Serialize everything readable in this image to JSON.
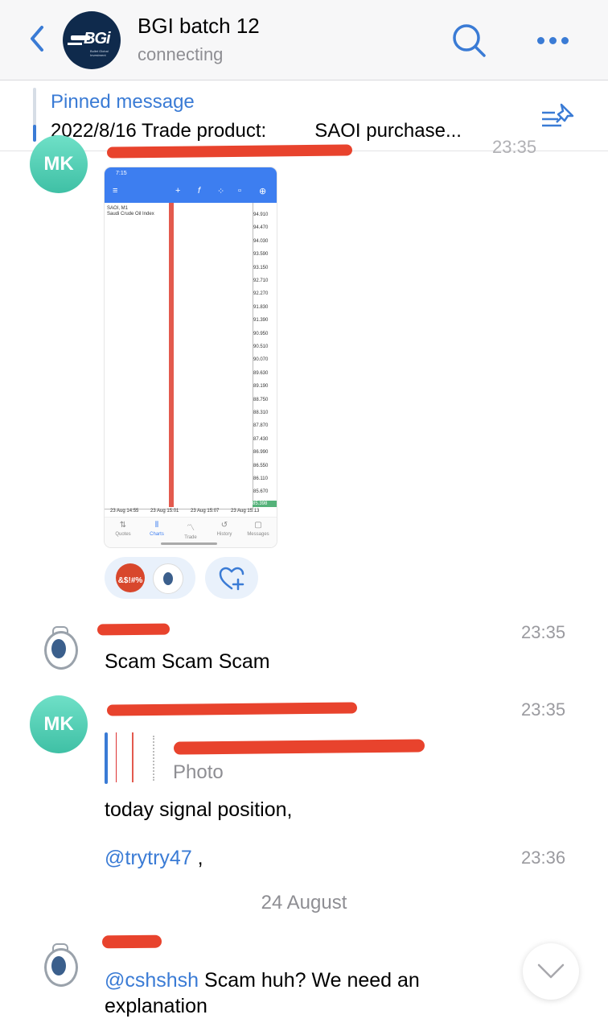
{
  "header": {
    "title": "BGI batch 12",
    "status": "connecting",
    "logo_text": "BGi",
    "logo_subtext": "Bullet Global Investment"
  },
  "pinned": {
    "label": "Pinned message",
    "text": "2022/8/16 Trade product:         SAOI purchase..."
  },
  "messages": [
    {
      "avatar_initials": "MK",
      "time": "23:35",
      "attachment": {
        "status_time": "7:15",
        "symbol": "SAOI, M1",
        "symbol_name": "Saudi Crude Oil Index",
        "price_ticks": [
          "94.910",
          "94.470",
          "94.030",
          "93.590",
          "93.150",
          "92.710",
          "92.270",
          "91.830",
          "91.390",
          "90.950",
          "90.510",
          "90.070",
          "89.630",
          "89.190",
          "88.750",
          "88.310",
          "87.870",
          "87.430",
          "86.990",
          "86.550",
          "86.110",
          "85.670"
        ],
        "current_price": "85.398",
        "x_ticks": [
          "23 Aug 14:55",
          "23 Aug 15:01",
          "23 Aug 15:07",
          "23 Aug 15:13"
        ],
        "nav": [
          "Quotes",
          "Charts",
          "Trade",
          "History",
          "Messages"
        ]
      },
      "reaction_emoji": "&$!#%"
    },
    {
      "time": "23:35",
      "text": "Scam Scam Scam"
    },
    {
      "avatar_initials": "MK",
      "time": "23:35",
      "reply_sub": "Photo",
      "text": "today signal position,",
      "mention": "@trytry47",
      "mention_suffix": " ,",
      "mention_time": "23:36"
    }
  ],
  "date_separator": "24 August",
  "last_message": {
    "mention": "@cshshsh",
    "text_line1": " Scam huh? We need an",
    "text_line2": "explanation"
  },
  "colors": {
    "accent": "#3a7bd5",
    "redaction": "#e8432d",
    "avatar_mk": "#4fcfb3"
  }
}
